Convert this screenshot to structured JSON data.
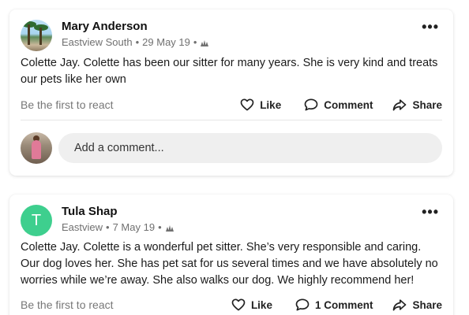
{
  "posts": [
    {
      "author": "Mary Anderson",
      "location": "Eastview South",
      "date": "29 May 19",
      "text": "Colette Jay. Colette has been our sitter for many years. She is very kind and treats our pets like her own",
      "react_hint": "Be the first to react",
      "like_label": "Like",
      "comment_label": "Comment",
      "share_label": "Share",
      "comment_placeholder": "Add a comment...",
      "avatar": "photo-icon"
    },
    {
      "author": "Tula Shap",
      "avatar_letter": "T",
      "location": "Eastview",
      "date": "7 May 19",
      "text": "Colette Jay. Colette is a wonderful pet sitter. She’s very responsible and caring. Our dog loves her. She has pet sat for us several times and we have absolutely no worries while we’re away. She also walks our dog. We highly recommend her!",
      "react_hint": "Be the first to react",
      "like_label": "Like",
      "comment_label": "1 Comment",
      "share_label": "Share"
    }
  ],
  "colors": {
    "avatar_green": "#3ecf8e",
    "input_bg": "#efefef",
    "meta_text": "#707070"
  },
  "icons": {
    "more": "more-icon",
    "neighborhood": "neighborhood-icon",
    "like": "heart-icon",
    "comment": "speech-bubble-icon",
    "share": "share-arrow-icon"
  }
}
